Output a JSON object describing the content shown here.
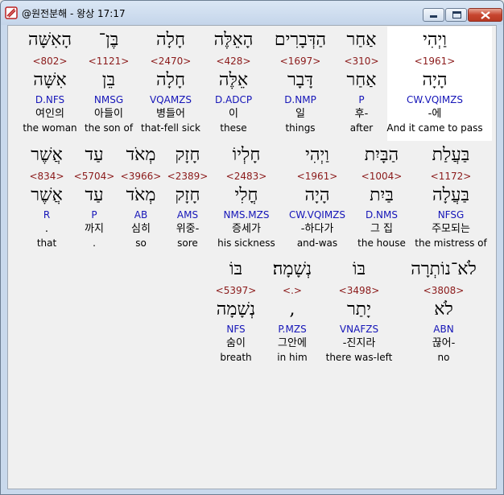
{
  "window": {
    "title": "@원전분해 - 왕상 17:17"
  },
  "rows": [
    [
      {
        "heb1": "הָאִשָּׁה",
        "num": "<802>",
        "heb2": "אִשָּׁה",
        "morph": "D.NFS",
        "kor": "여인의",
        "eng": "the woman"
      },
      {
        "heb1": "בֶּן־",
        "num": "<1121>",
        "heb2": "בֵּן",
        "morph": "NMSG",
        "kor": "아들이",
        "eng": "the son of"
      },
      {
        "heb1": "חָלָה",
        "num": "<2470>",
        "heb2": "חָלָה",
        "morph": "VQAMZS",
        "kor": "병들어",
        "eng": "that-fell sick"
      },
      {
        "heb1": "הָאֵלֶּה",
        "num": "<428>",
        "heb2": "אֵלֶּה",
        "morph": "D.ADCP",
        "kor": "이",
        "eng": "these"
      },
      {
        "heb1": "הַדְּבָרִים",
        "num": "<1697>",
        "heb2": "דָּבָר",
        "morph": "D.NMP",
        "kor": "일",
        "eng": "things"
      },
      {
        "heb1": "אַחַר",
        "num": "<310>",
        "heb2": "אַחַר",
        "morph": "P",
        "kor": "후-",
        "eng": "after"
      },
      {
        "heb1": "וַיְהִי",
        "num": "<1961>",
        "heb2": "הָיָה",
        "morph": "CW.VQIMZS",
        "kor": "-에",
        "eng": "And it came to pass"
      }
    ],
    [
      {
        "heb1": "אֲשֶׁר",
        "num": "<834>",
        "heb2": "אֲשֶׁר",
        "morph": "R",
        "kor": ".",
        "eng": "that"
      },
      {
        "heb1": "עַד",
        "num": "<5704>",
        "heb2": "עַד",
        "morph": "P",
        "kor": "까지",
        "eng": "."
      },
      {
        "heb1": "מְאֹד",
        "num": "<3966>",
        "heb2": "מְאֹד",
        "morph": "AB",
        "kor": "심히",
        "eng": "so"
      },
      {
        "heb1": "חָזָק",
        "num": "<2389>",
        "heb2": "חָזָק",
        "morph": "AMS",
        "kor": "위중-",
        "eng": "sore"
      },
      {
        "heb1": "חָלְיוֹ",
        "num": "<2483>",
        "heb2": "חֳלִי",
        "morph": "NMS.MZS",
        "kor": "증세가",
        "eng": "his sickness"
      },
      {
        "heb1": "וַיְהִי",
        "num": "<1961>",
        "heb2": "הָיָה",
        "morph": "CW.VQIMZS",
        "kor": "-하다가",
        "eng": "and-was"
      },
      {
        "heb1": "הַבָּיִת",
        "num": "<1004>",
        "heb2": "בַּיִת",
        "morph": "D.NMS",
        "kor": "그 집",
        "eng": "the house"
      },
      {
        "heb1": "בַּעֲלַת",
        "num": "<1172>",
        "heb2": "בַּעֲלָה",
        "morph": "NFSG",
        "kor": "주모되는",
        "eng": "the mistress of"
      }
    ],
    [
      {
        "heb1": "בּוֹ",
        "num": "<5397>",
        "heb2": "נְשָׁמָה",
        "morph": "NFS",
        "kor": "숨이",
        "eng": "breath"
      },
      {
        "heb1": "נְשָׁמָה׃",
        "num": "<.>",
        "heb2": ",",
        "morph": "P.MZS",
        "kor": "그안에",
        "eng": "in him"
      },
      {
        "heb1": "בּוֹ",
        "num": "<3498>",
        "heb2": "יָתַר",
        "morph": "VNAFZS",
        "kor": "-진지라",
        "eng": "there was-left"
      },
      {
        "heb1": "לֹא־נוֹתְרָה",
        "num": "<3808>",
        "heb2": "לֹא",
        "morph": "ABN",
        "kor": "끊어-",
        "eng": "no"
      }
    ]
  ]
}
